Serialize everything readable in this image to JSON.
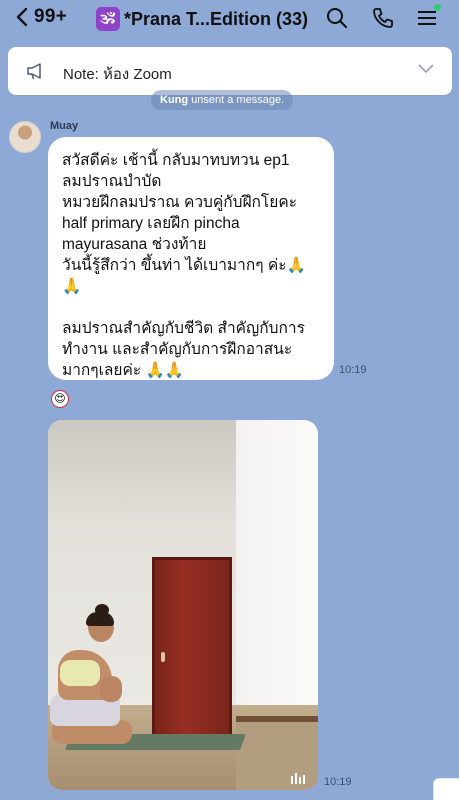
{
  "header": {
    "back_count": "99+",
    "title_icon": "🕉",
    "title": "*Prana T...Edition (33)",
    "icons": [
      "search-icon",
      "phone-icon",
      "menu-icon"
    ],
    "online_dot_color": "#2ecc71"
  },
  "note": {
    "icon": "megaphone-icon",
    "text": "Note: ห้อง Zoom"
  },
  "system_message": {
    "user": "Kung",
    "text": " unsent a message."
  },
  "message": {
    "sender": "Muay",
    "text": "สวัสดีค่ะ เช้านี้ กลับมาทบทวน ep1\nลมปราณบำบัด\nหมวยฝึกลมปราณ ควบคู่กับฝึกโยคะ\nhalf primary เลยฝึก pincha\nmayurasana ช่วงท้าย\nวันนี้รู้สึกว่า ขึ้นท่า ได้เบามากๆ ค่ะ🙏\n🙏\n\nลมปราณสำคัญกับชีวิต สำคัญกับการ\nทำงาน และสำคัญกับการฝึกอาสนะ\nมากๆเลยค่ะ 🙏🙏",
    "time": "10:19"
  },
  "reaction": "😍",
  "video": {
    "time": "10:19",
    "icon": "video-bars-icon"
  }
}
